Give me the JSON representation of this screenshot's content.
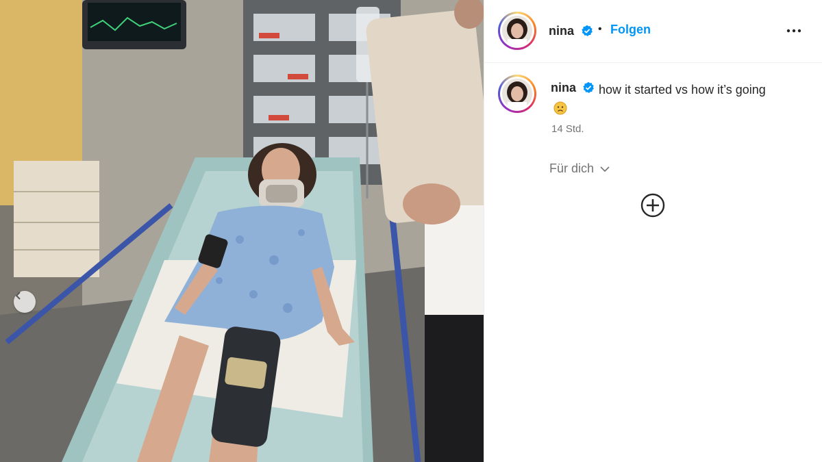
{
  "post": {
    "username": "nina",
    "follow_label": "Folgen",
    "separator": "•",
    "caption": "how it started vs how it’s going",
    "caption_emoji": "worried-face",
    "timestamp": "14 Std.",
    "for_you_label": "Für dich"
  },
  "icons": {
    "verified": "verified-badge-icon",
    "more": "more-options-icon",
    "chevron": "chevron-down-icon",
    "add": "plus-circle-icon",
    "carousel_prev": "chevron-left-icon"
  },
  "colors": {
    "accent": "#0095f6",
    "verified": "#0095f6",
    "text": "#262626",
    "muted": "#737373"
  }
}
